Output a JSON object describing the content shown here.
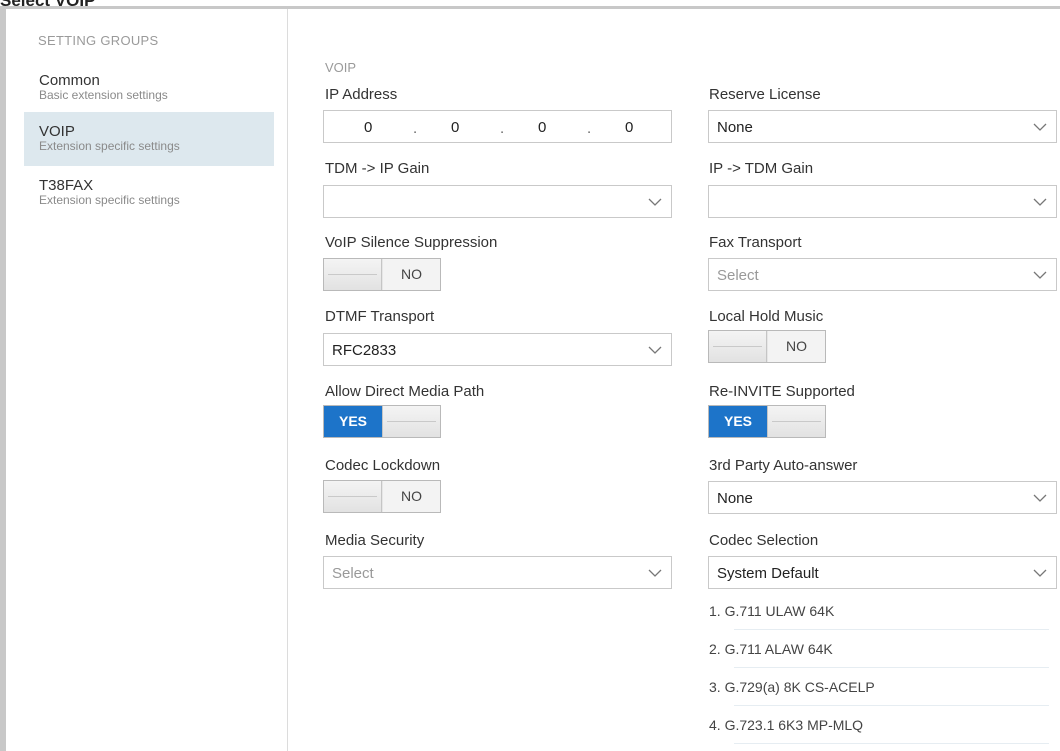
{
  "page": {
    "title": "Select VOIP"
  },
  "sidebar": {
    "header": "SETTING GROUPS",
    "items": [
      {
        "label": "Common",
        "desc": "Basic extension settings",
        "active": false
      },
      {
        "label": "VOIP",
        "desc": "Extension specific settings",
        "active": true
      },
      {
        "label": "T38FAX",
        "desc": "Extension specific settings",
        "active": false
      }
    ]
  },
  "section": {
    "title": "VOIP"
  },
  "fields": {
    "ip_address": {
      "label": "IP Address",
      "octets": [
        "0",
        "0",
        "0",
        "0"
      ]
    },
    "reserve_license": {
      "label": "Reserve License",
      "value": "None"
    },
    "tdm_ip_gain": {
      "label": "TDM -> IP Gain",
      "value": ""
    },
    "ip_tdm_gain": {
      "label": "IP -> TDM Gain",
      "value": ""
    },
    "voip_silence_suppression": {
      "label": "VoIP Silence Suppression",
      "state": "NO"
    },
    "fax_transport": {
      "label": "Fax Transport",
      "placeholder": "Select"
    },
    "dtmf_transport": {
      "label": "DTMF Transport",
      "value": "RFC2833"
    },
    "local_hold_music": {
      "label": "Local Hold Music",
      "state": "NO"
    },
    "allow_direct_media_path": {
      "label": "Allow Direct Media Path",
      "state": "YES"
    },
    "reinvite_supported": {
      "label": "Re-INVITE Supported",
      "state": "YES"
    },
    "codec_lockdown": {
      "label": "Codec Lockdown",
      "state": "NO"
    },
    "third_party_auto_answer": {
      "label": "3rd Party Auto-answer",
      "value": "None"
    },
    "media_security": {
      "label": "Media Security",
      "placeholder": "Select"
    },
    "codec_selection": {
      "label": "Codec Selection",
      "value": "System Default"
    }
  },
  "codecs": [
    "1. G.711 ULAW 64K",
    "2. G.711 ALAW 64K",
    "3. G.729(a) 8K CS-ACELP",
    "4. G.723.1 6K3 MP-MLQ"
  ],
  "colors": {
    "accent": "#1d74c9",
    "active_bg": "#dde8ee",
    "border": "#c9c9c9"
  },
  "icons": {
    "dropdown": "chevron-down-icon"
  }
}
